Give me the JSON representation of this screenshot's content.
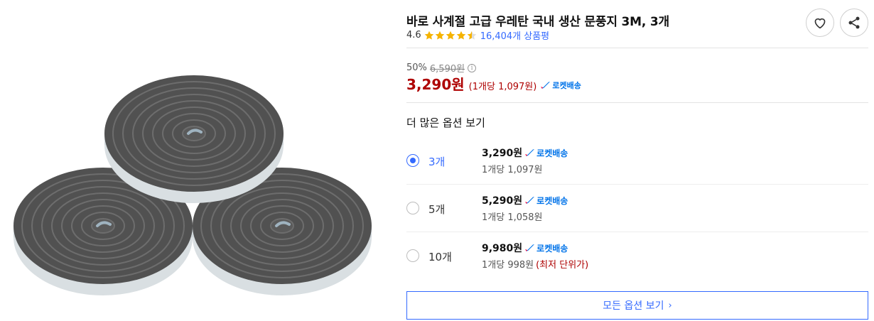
{
  "product": {
    "title": "바로 사계절 고급 우레탄 국내 생산 문풍지 3M, 3개",
    "rating": "4.6",
    "stars": 4.5,
    "review_count": "16,404개 상품평",
    "image_alt": "grey foam weather-strip rolls"
  },
  "actions": {
    "wishlist_icon": "heart-icon",
    "share_icon": "share-icon"
  },
  "pricing": {
    "discount_rate": "50%",
    "original_price": "6,590원",
    "info_icon": "i",
    "sale_price": "3,290원",
    "unit_price": "(1개당 1,097원)",
    "rocket_label": "로켓배송"
  },
  "options": {
    "heading": "더 많은 옵션 보기",
    "items": [
      {
        "label": "3개",
        "price": "3,290원",
        "rocket": "로켓배송",
        "unit": "1개당 1,097원",
        "note": "",
        "selected": true
      },
      {
        "label": "5개",
        "price": "5,290원",
        "rocket": "로켓배송",
        "unit": "1개당 1,058원",
        "note": "",
        "selected": false
      },
      {
        "label": "10개",
        "price": "9,980원",
        "rocket": "로켓배송",
        "unit": "1개당 998원",
        "note": "(최저 단위가)",
        "selected": false
      }
    ],
    "all_options_label": "모든 옵션 보기",
    "all_options_chevron": "›"
  },
  "colors": {
    "accent_blue": "#346aff",
    "price_red": "#ae0000",
    "star_yellow": "#f5b301",
    "rocket_blue": "#0073e9"
  }
}
